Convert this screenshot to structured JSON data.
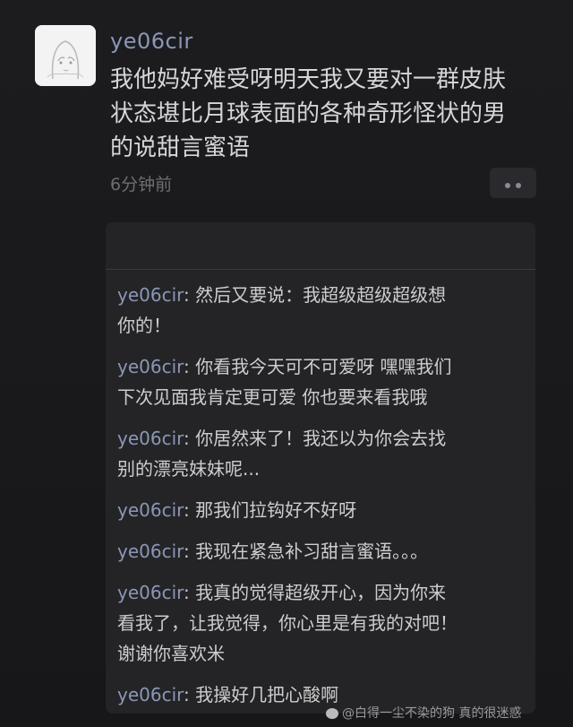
{
  "post": {
    "username": "ye06cir",
    "text_lines": [
      "我他妈好难受呀明天我又要对一群皮肤",
      "状态堪比月球表面的各种奇形怪状的男",
      "的说甜言蜜语"
    ],
    "timestamp": "6分钟前",
    "avatar_icon": "anime-girl-avatar",
    "more_icon": "more-dots-icon"
  },
  "comments": [
    {
      "author": "ye06cir",
      "sep": ": ",
      "lines": [
        "然后又要说：我超级超级超级想",
        "你的！"
      ]
    },
    {
      "author": "ye06cir",
      "sep": ": ",
      "lines": [
        "你看我今天可不可爱呀 嘿嘿我们",
        "下次见面我肯定更可爱 你也要来看我哦"
      ]
    },
    {
      "author": "ye06cir",
      "sep": ": ",
      "lines": [
        "你居然来了！我还以为你会去找",
        "别的漂亮妹妹呢..."
      ]
    },
    {
      "author": "ye06cir",
      "sep": ": ",
      "lines": [
        "那我们拉钩好不好呀"
      ]
    },
    {
      "author": "ye06cir",
      "sep": ": ",
      "lines": [
        "我现在紧急补习甜言蜜语。。。"
      ]
    },
    {
      "author": "ye06cir",
      "sep": ": ",
      "lines": [
        "我真的觉得超级开心，因为你来",
        "看我了，让我觉得，你心里是有我的对吧！",
        "谢谢你喜欢米"
      ]
    },
    {
      "author": "ye06cir",
      "sep": ": ",
      "lines": [
        "我操好几把心酸啊"
      ]
    }
  ],
  "watermark": {
    "text": "@白得一尘不染的狗 真的很迷惑",
    "icon": "weibo-icon"
  },
  "colors": {
    "background": "#1a1a1c",
    "name_color": "#8a97b5",
    "text_color": "#d6d6d6",
    "comment_bg": "#242427"
  }
}
